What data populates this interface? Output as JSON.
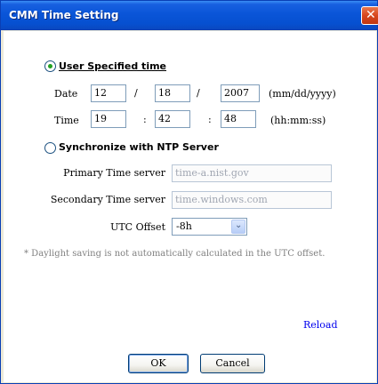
{
  "window": {
    "title": "CMM Time Setting"
  },
  "user_time": {
    "label": "User Specified time",
    "selected": true,
    "date_label": "Date",
    "month": "12",
    "day": "18",
    "year": "2007",
    "date_sep": "/",
    "date_format": "(mm/dd/yyyy)",
    "time_label": "Time",
    "hour": "19",
    "minute": "42",
    "second": "48",
    "time_sep": ":",
    "time_format": "(hh:mm:ss)"
  },
  "ntp": {
    "label": "Synchronize with NTP Server",
    "selected": false,
    "primary_label": "Primary Time server",
    "primary_value": "time-a.nist.gov",
    "secondary_label": "Secondary Time server",
    "secondary_value": "time.windows.com",
    "utc_label": "UTC Offset",
    "utc_value": "-8h"
  },
  "note": "* Daylight saving is not automatically calculated in the UTC offset.",
  "reload_label": "Reload",
  "buttons": {
    "ok": "OK",
    "cancel": "Cancel"
  },
  "icons": {
    "close": "close-icon",
    "dropdown": "chevron-down-icon",
    "radio": "radio-icon"
  },
  "colors": {
    "titlebar": "#0a55d8",
    "close": "#d8461e",
    "radio_dot": "#21a121",
    "link": "#0000ee"
  }
}
